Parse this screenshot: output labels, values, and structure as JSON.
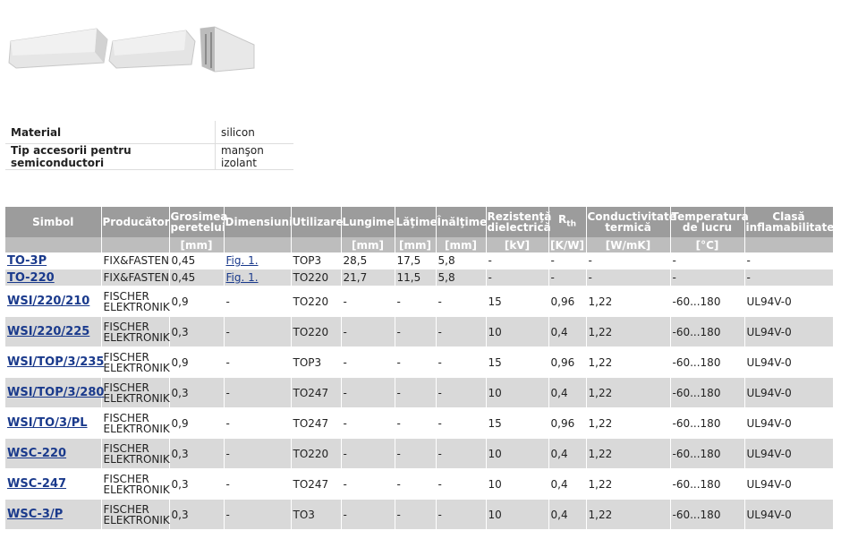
{
  "attributes": [
    {
      "label": "Material",
      "value": "silicon"
    },
    {
      "label": "Tip accesorii pentru semiconductori",
      "value": "manşon izolant"
    }
  ],
  "table": {
    "headers": [
      "Simbol",
      "Producător",
      "Grosimea peretelui",
      "Dimensiuni",
      "Utilizare",
      "Lungime",
      "Lăţime",
      "Înălţime",
      "Rezistenţă dielectrică",
      "R",
      "Conductivitate termică",
      "Temperatura de lucru",
      "Clasă inflamabilitate"
    ],
    "rth_sub": "th",
    "units": [
      "",
      "",
      "[mm]",
      "",
      "",
      "[mm]",
      "[mm]",
      "[mm]",
      "[kV]",
      "[K/W]",
      "[W/mK]",
      "[°C]",
      ""
    ],
    "rows": [
      [
        "TO-3P",
        "FIX&FASTEN",
        "0,45",
        "Fig. 1.",
        "TOP3",
        "28,5",
        "17,5",
        "5,8",
        "-",
        "-",
        "-",
        "-",
        "-"
      ],
      [
        "TO-220",
        "FIX&FASTEN",
        "0,45",
        "Fig. 1.",
        "TO220",
        "21,7",
        "11,5",
        "5,8",
        "-",
        "-",
        "-",
        "-",
        "-"
      ],
      [
        "WSI/220/210",
        "FISCHER ELEKTRONIK",
        "0,9",
        "-",
        "TO220",
        "-",
        "-",
        "-",
        "15",
        "0,96",
        "1,22",
        "-60...180",
        "UL94V-0"
      ],
      [
        "WSI/220/225",
        "FISCHER ELEKTRONIK",
        "0,3",
        "-",
        "TO220",
        "-",
        "-",
        "-",
        "10",
        "0,4",
        "1,22",
        "-60...180",
        "UL94V-0"
      ],
      [
        "WSI/TOP/3/235",
        "FISCHER ELEKTRONIK",
        "0,9",
        "-",
        "TOP3",
        "-",
        "-",
        "-",
        "15",
        "0,96",
        "1,22",
        "-60...180",
        "UL94V-0"
      ],
      [
        "WSI/TOP/3/280",
        "FISCHER ELEKTRONIK",
        "0,3",
        "-",
        "TO247",
        "-",
        "-",
        "-",
        "10",
        "0,4",
        "1,22",
        "-60...180",
        "UL94V-0"
      ],
      [
        "WSI/TO/3/PL",
        "FISCHER ELEKTRONIK",
        "0,9",
        "-",
        "TO247",
        "-",
        "-",
        "-",
        "15",
        "0,96",
        "1,22",
        "-60...180",
        "UL94V-0"
      ],
      [
        "WSC-220",
        "FISCHER ELEKTRONIK",
        "0,3",
        "-",
        "TO220",
        "-",
        "-",
        "-",
        "10",
        "0,4",
        "1,22",
        "-60...180",
        "UL94V-0"
      ],
      [
        "WSC-247",
        "FISCHER ELEKTRONIK",
        "0,3",
        "-",
        "TO247",
        "-",
        "-",
        "-",
        "10",
        "0,4",
        "1,22",
        "-60...180",
        "UL94V-0"
      ],
      [
        "WSC-3/P",
        "FISCHER ELEKTRONIK",
        "0,3",
        "-",
        "TO3",
        "-",
        "-",
        "-",
        "10",
        "0,4",
        "1,22",
        "-60...180",
        "UL94V-0"
      ]
    ]
  }
}
